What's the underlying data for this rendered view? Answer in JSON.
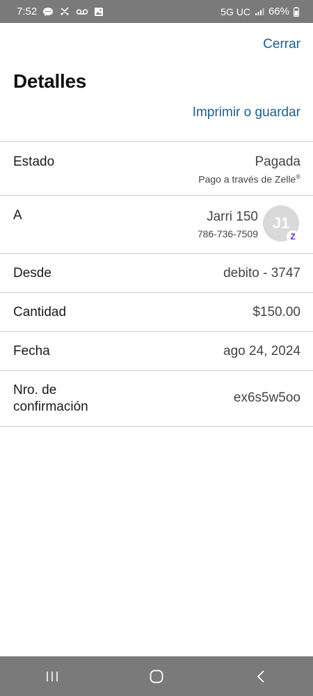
{
  "status_bar": {
    "time": "7:52",
    "network": "5G UC",
    "battery": "66%"
  },
  "header": {
    "close_label": "Cerrar",
    "title": "Detalles",
    "print_label": "Imprimir o guardar"
  },
  "details": {
    "estado": {
      "label": "Estado",
      "value": "Pagada",
      "sub": "Pago a través de Zelle",
      "sub_mark": "®"
    },
    "a": {
      "label": "A",
      "name": "Jarri 150",
      "phone": "786-736-7509",
      "avatar_initials": "J1",
      "badge": "Z"
    },
    "desde": {
      "label": "Desde",
      "value": "debito - 3747"
    },
    "cantidad": {
      "label": "Cantidad",
      "value": "$150.00"
    },
    "fecha": {
      "label": "Fecha",
      "value": "ago 24, 2024"
    },
    "confirmacion": {
      "label": "Nro. de confirmación",
      "value": "ex6s5w5oo"
    }
  },
  "colors": {
    "link": "#1a5e94",
    "system_bars": "#7a7a7a",
    "zelle_purple": "#6d1ed4"
  },
  "icons": {
    "status_left": [
      "message-icon",
      "missed-call-icon",
      "voicemail-icon",
      "gallery-icon"
    ],
    "status_right": [
      "signal-icon",
      "battery-icon"
    ],
    "nav": [
      "recent-apps-icon",
      "home-icon",
      "back-icon"
    ]
  }
}
